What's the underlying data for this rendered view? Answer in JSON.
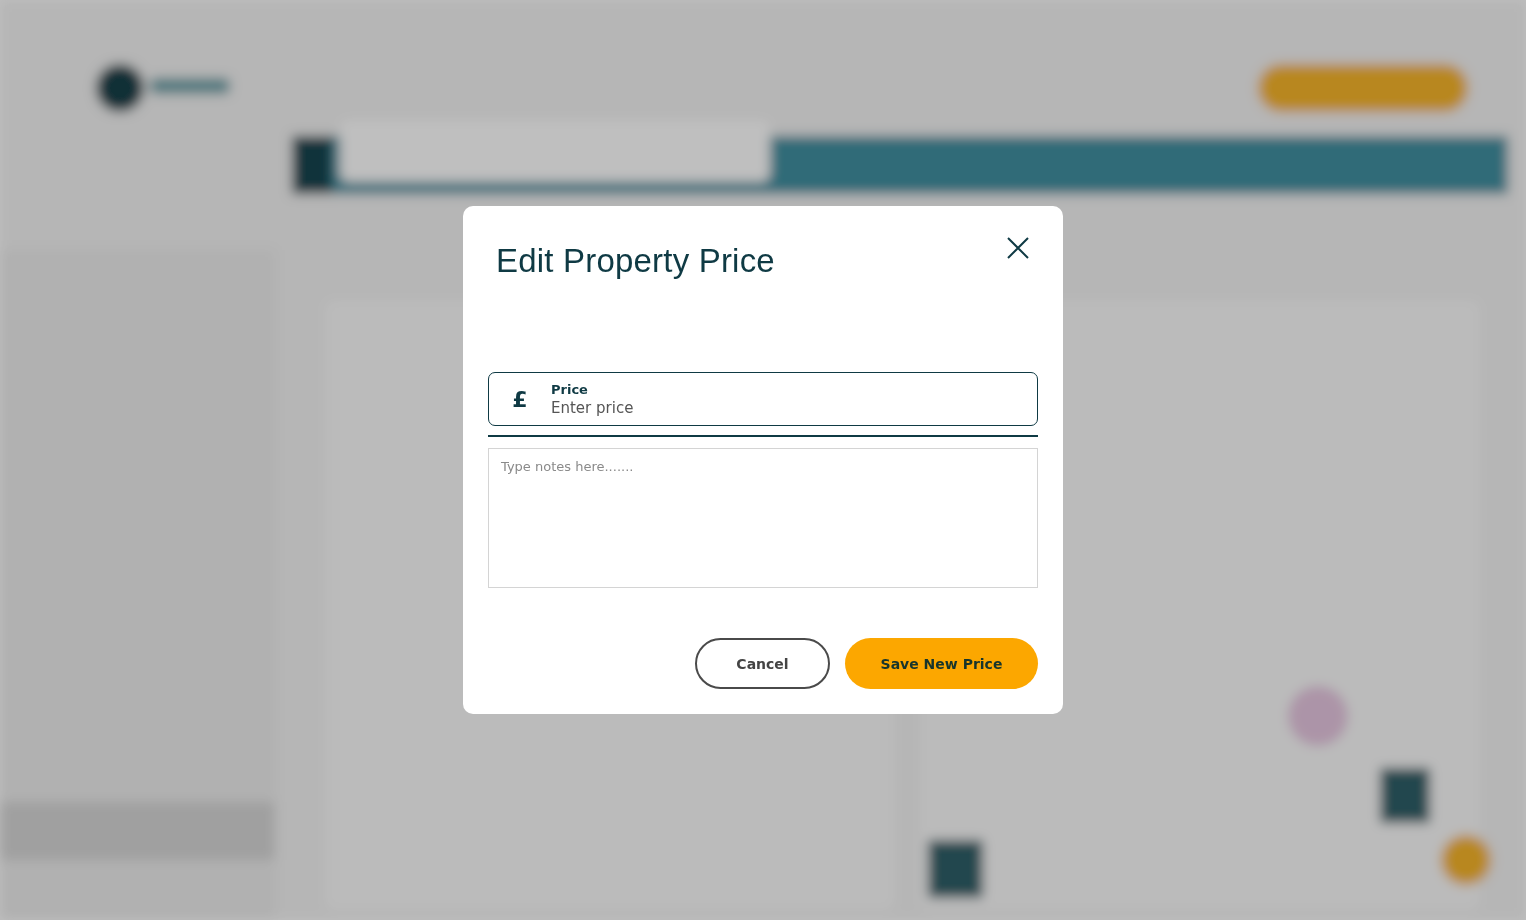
{
  "dialog": {
    "title": "Edit Property Price",
    "price_field": {
      "currency": "£",
      "label": "Price",
      "placeholder": "Enter price"
    },
    "notes_field": {
      "placeholder": "Type notes here......."
    },
    "buttons": [
      {
        "label": "Cancel",
        "kind": "secondary"
      },
      {
        "label": "Save New Price",
        "kind": "primary"
      }
    ]
  }
}
